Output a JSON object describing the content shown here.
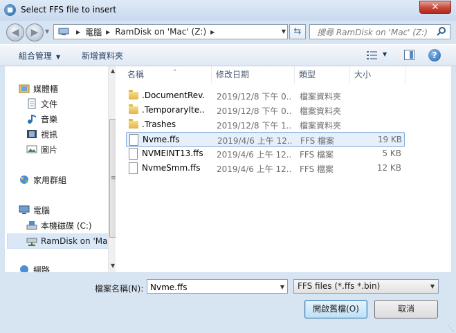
{
  "window": {
    "title": "Select FFS file to insert",
    "close_label": "✕"
  },
  "nav": {
    "address": [
      "電腦",
      "RamDisk on 'Mac' (Z:)"
    ],
    "search_placeholder": "搜尋 RamDisk on 'Mac' (Z:)"
  },
  "toolbar": {
    "organize_label": "組合管理",
    "new_folder_label": "新增資料夾",
    "help_label": "?"
  },
  "sidebar": {
    "items": [
      {
        "label": "媒體櫃",
        "icon": "library-icon"
      },
      {
        "label": "文件",
        "icon": "documents-icon"
      },
      {
        "label": "音樂",
        "icon": "music-icon"
      },
      {
        "label": "視訊",
        "icon": "video-icon"
      },
      {
        "label": "圖片",
        "icon": "pictures-icon"
      },
      {
        "label": "家用群組",
        "icon": "homegroup-icon"
      },
      {
        "label": "電腦",
        "icon": "computer-icon"
      },
      {
        "label": "本機磁碟 (C:)",
        "icon": "local-disk-icon"
      },
      {
        "label": "RamDisk on 'Ma",
        "icon": "network-drive-icon",
        "selected": true
      },
      {
        "label": "網路",
        "icon": "network-icon"
      }
    ]
  },
  "files": {
    "columns": [
      "名稱",
      "修改日期",
      "類型",
      "大小"
    ],
    "rows": [
      {
        "name": ".DocumentRev...",
        "date": "2019/12/8 下午 0...",
        "type": "檔案資料夾",
        "size": "",
        "kind": "folder"
      },
      {
        "name": ".TemporaryIte...",
        "date": "2019/12/8 下午 0...",
        "type": "檔案資料夾",
        "size": "",
        "kind": "folder"
      },
      {
        "name": ".Trashes",
        "date": "2019/12/8 下午 1...",
        "type": "檔案資料夾",
        "size": "",
        "kind": "folder"
      },
      {
        "name": "Nvme.ffs",
        "date": "2019/4/6 上午 12...",
        "type": "FFS 檔案",
        "size": "19 KB",
        "kind": "file",
        "selected": true
      },
      {
        "name": "NVMEINT13.ffs",
        "date": "2019/4/6 上午 12...",
        "type": "FFS 檔案",
        "size": "5 KB",
        "kind": "file"
      },
      {
        "name": "NvmeSmm.ffs",
        "date": "2019/4/6 上午 12...",
        "type": "FFS 檔案",
        "size": "12 KB",
        "kind": "file"
      }
    ]
  },
  "bottom": {
    "filename_label": "檔案名稱(N):",
    "filename_value": "Nvme.ffs",
    "filter_value": "FFS files (*.ffs *.bin)",
    "open_label": "開啟舊檔(O)",
    "cancel_label": "取消"
  }
}
